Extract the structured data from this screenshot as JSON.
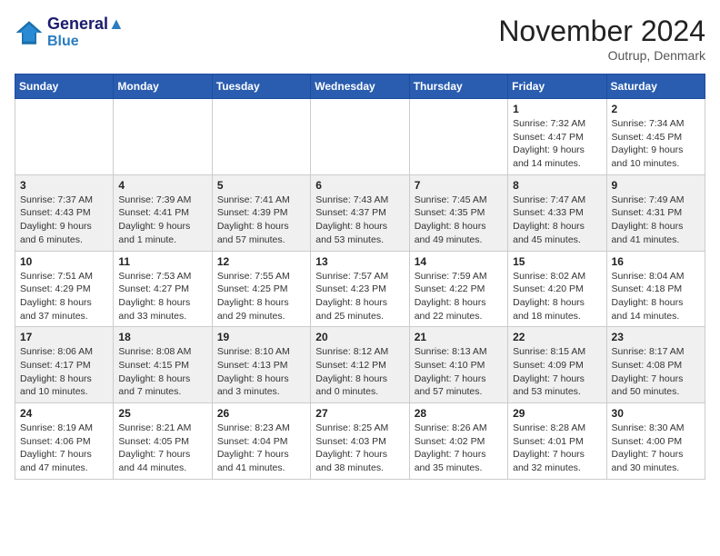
{
  "header": {
    "logo_line1": "General",
    "logo_line2": "Blue",
    "month": "November 2024",
    "location": "Outrup, Denmark"
  },
  "weekdays": [
    "Sunday",
    "Monday",
    "Tuesday",
    "Wednesday",
    "Thursday",
    "Friday",
    "Saturday"
  ],
  "weeks": [
    [
      {
        "day": "",
        "info": ""
      },
      {
        "day": "",
        "info": ""
      },
      {
        "day": "",
        "info": ""
      },
      {
        "day": "",
        "info": ""
      },
      {
        "day": "",
        "info": ""
      },
      {
        "day": "1",
        "info": "Sunrise: 7:32 AM\nSunset: 4:47 PM\nDaylight: 9 hours and 14 minutes."
      },
      {
        "day": "2",
        "info": "Sunrise: 7:34 AM\nSunset: 4:45 PM\nDaylight: 9 hours and 10 minutes."
      }
    ],
    [
      {
        "day": "3",
        "info": "Sunrise: 7:37 AM\nSunset: 4:43 PM\nDaylight: 9 hours and 6 minutes."
      },
      {
        "day": "4",
        "info": "Sunrise: 7:39 AM\nSunset: 4:41 PM\nDaylight: 9 hours and 1 minute."
      },
      {
        "day": "5",
        "info": "Sunrise: 7:41 AM\nSunset: 4:39 PM\nDaylight: 8 hours and 57 minutes."
      },
      {
        "day": "6",
        "info": "Sunrise: 7:43 AM\nSunset: 4:37 PM\nDaylight: 8 hours and 53 minutes."
      },
      {
        "day": "7",
        "info": "Sunrise: 7:45 AM\nSunset: 4:35 PM\nDaylight: 8 hours and 49 minutes."
      },
      {
        "day": "8",
        "info": "Sunrise: 7:47 AM\nSunset: 4:33 PM\nDaylight: 8 hours and 45 minutes."
      },
      {
        "day": "9",
        "info": "Sunrise: 7:49 AM\nSunset: 4:31 PM\nDaylight: 8 hours and 41 minutes."
      }
    ],
    [
      {
        "day": "10",
        "info": "Sunrise: 7:51 AM\nSunset: 4:29 PM\nDaylight: 8 hours and 37 minutes."
      },
      {
        "day": "11",
        "info": "Sunrise: 7:53 AM\nSunset: 4:27 PM\nDaylight: 8 hours and 33 minutes."
      },
      {
        "day": "12",
        "info": "Sunrise: 7:55 AM\nSunset: 4:25 PM\nDaylight: 8 hours and 29 minutes."
      },
      {
        "day": "13",
        "info": "Sunrise: 7:57 AM\nSunset: 4:23 PM\nDaylight: 8 hours and 25 minutes."
      },
      {
        "day": "14",
        "info": "Sunrise: 7:59 AM\nSunset: 4:22 PM\nDaylight: 8 hours and 22 minutes."
      },
      {
        "day": "15",
        "info": "Sunrise: 8:02 AM\nSunset: 4:20 PM\nDaylight: 8 hours and 18 minutes."
      },
      {
        "day": "16",
        "info": "Sunrise: 8:04 AM\nSunset: 4:18 PM\nDaylight: 8 hours and 14 minutes."
      }
    ],
    [
      {
        "day": "17",
        "info": "Sunrise: 8:06 AM\nSunset: 4:17 PM\nDaylight: 8 hours and 10 minutes."
      },
      {
        "day": "18",
        "info": "Sunrise: 8:08 AM\nSunset: 4:15 PM\nDaylight: 8 hours and 7 minutes."
      },
      {
        "day": "19",
        "info": "Sunrise: 8:10 AM\nSunset: 4:13 PM\nDaylight: 8 hours and 3 minutes."
      },
      {
        "day": "20",
        "info": "Sunrise: 8:12 AM\nSunset: 4:12 PM\nDaylight: 8 hours and 0 minutes."
      },
      {
        "day": "21",
        "info": "Sunrise: 8:13 AM\nSunset: 4:10 PM\nDaylight: 7 hours and 57 minutes."
      },
      {
        "day": "22",
        "info": "Sunrise: 8:15 AM\nSunset: 4:09 PM\nDaylight: 7 hours and 53 minutes."
      },
      {
        "day": "23",
        "info": "Sunrise: 8:17 AM\nSunset: 4:08 PM\nDaylight: 7 hours and 50 minutes."
      }
    ],
    [
      {
        "day": "24",
        "info": "Sunrise: 8:19 AM\nSunset: 4:06 PM\nDaylight: 7 hours and 47 minutes."
      },
      {
        "day": "25",
        "info": "Sunrise: 8:21 AM\nSunset: 4:05 PM\nDaylight: 7 hours and 44 minutes."
      },
      {
        "day": "26",
        "info": "Sunrise: 8:23 AM\nSunset: 4:04 PM\nDaylight: 7 hours and 41 minutes."
      },
      {
        "day": "27",
        "info": "Sunrise: 8:25 AM\nSunset: 4:03 PM\nDaylight: 7 hours and 38 minutes."
      },
      {
        "day": "28",
        "info": "Sunrise: 8:26 AM\nSunset: 4:02 PM\nDaylight: 7 hours and 35 minutes."
      },
      {
        "day": "29",
        "info": "Sunrise: 8:28 AM\nSunset: 4:01 PM\nDaylight: 7 hours and 32 minutes."
      },
      {
        "day": "30",
        "info": "Sunrise: 8:30 AM\nSunset: 4:00 PM\nDaylight: 7 hours and 30 minutes."
      }
    ]
  ]
}
